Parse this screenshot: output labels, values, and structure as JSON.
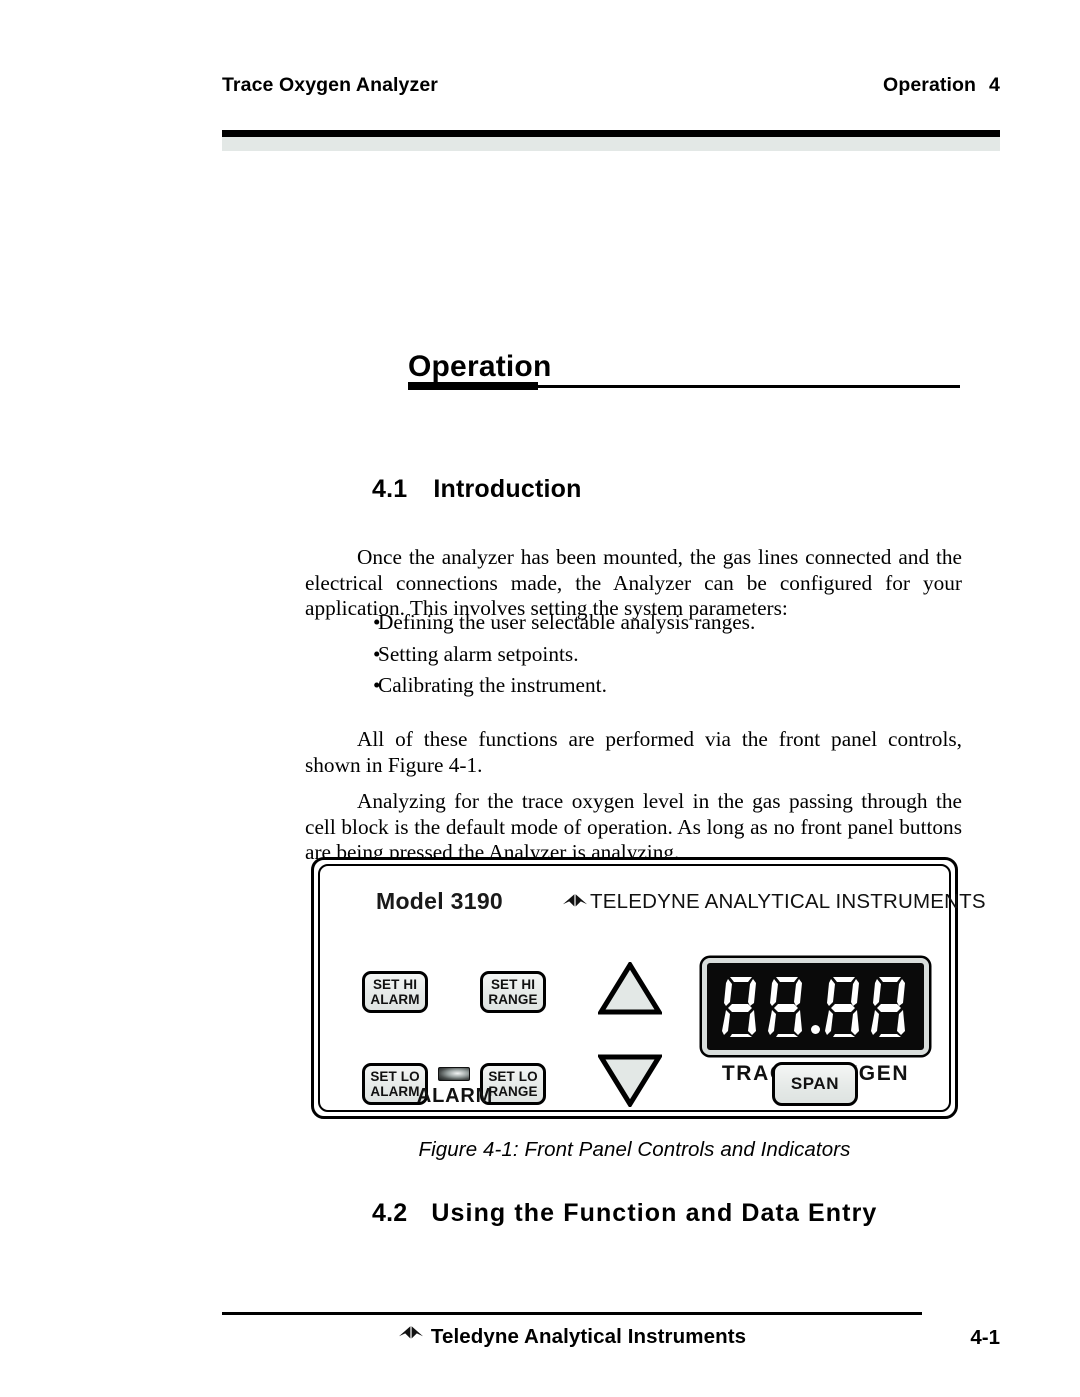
{
  "header": {
    "left_title": "Trace Oxygen Analyzer",
    "right_title": "Operation",
    "right_chapter": "4"
  },
  "chapter": {
    "title": "Operation"
  },
  "sections": {
    "intro": {
      "number": "4.1",
      "title": "Introduction"
    },
    "function_entry": {
      "number": "4.2",
      "title": "Using the Function and Data Entry"
    }
  },
  "body": {
    "paragraph_1": "Once the analyzer has been mounted, the gas lines connected and the electrical connections made, the Analyzer can be configured for your application. This involves setting the system parameters:",
    "bullets": [
      "Defining the user selectable analysis ranges.",
      "Setting alarm setpoints.",
      "Calibrating the instrument."
    ],
    "bullet_marker": "•",
    "paragraph_2": "All of these functions are performed via the front panel controls, shown in Figure 4-1.",
    "paragraph_3": "Analyzing for the trace oxygen level in the gas passing through the cell block is the default mode of operation. As long as no front panel buttons are being pressed the Analyzer is analyzing."
  },
  "figure": {
    "caption": "Figure 4-1: Front Panel Controls and Indicators",
    "panel": {
      "model_label": "Model 3190",
      "brand_text": "TELEDYNE ANALYTICAL INSTRUMENTS",
      "buttons": [
        {
          "line1": "SET HI",
          "line2": "ALARM"
        },
        {
          "line1": "SET HI",
          "line2": "RANGE"
        },
        {
          "line1": "SET LO",
          "line2": "ALARM"
        },
        {
          "line1": "SET LO",
          "line2": "RANGE"
        }
      ],
      "arrow_up": "increment-arrow",
      "arrow_down": "decrement-arrow",
      "display": {
        "value": "88.88",
        "digits": [
          "8",
          "8",
          "8",
          "8"
        ],
        "decimal_point_after_digit": 2,
        "label": "TRACE OXYGEN",
        "background_color": "#0a0a0a",
        "segment_color": "#ffffff"
      },
      "alarm_indicator": {
        "label": "ALARM",
        "state": "off"
      },
      "span_button": {
        "label": "SPAN"
      }
    }
  },
  "footer": {
    "company": "Teledyne Analytical Instruments",
    "page_number": "4-1"
  }
}
